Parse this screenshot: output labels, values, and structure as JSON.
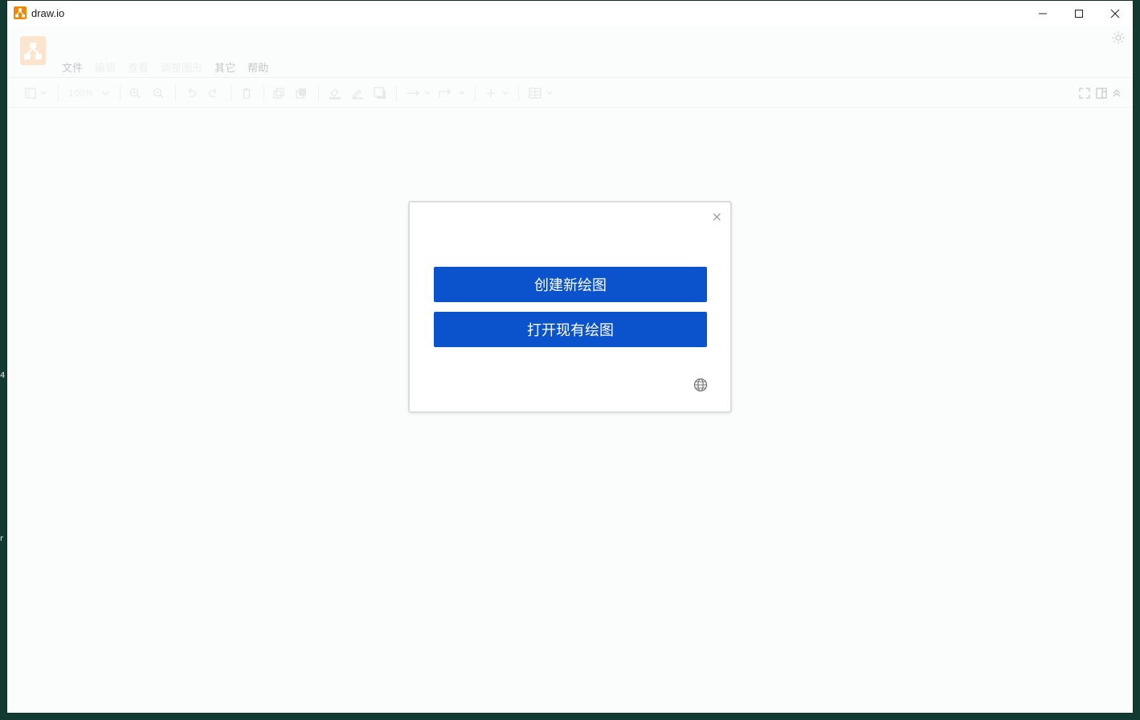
{
  "window": {
    "title": "draw.io"
  },
  "menu": {
    "items": [
      {
        "label": "文件",
        "enabled": true
      },
      {
        "label": "编辑",
        "enabled": false
      },
      {
        "label": "查看",
        "enabled": false
      },
      {
        "label": "调整图形",
        "enabled": false
      },
      {
        "label": "其它",
        "enabled": true
      },
      {
        "label": "帮助",
        "enabled": true
      }
    ]
  },
  "toolbar": {
    "zoom_label": "100%"
  },
  "dialog": {
    "create_label": "创建新绘图",
    "open_label": "打开现有绘图",
    "close_glyph": "×"
  },
  "background": {
    "glyph_a": "4",
    "glyph_b": "r"
  },
  "colors": {
    "primary_button": "#0b52cd",
    "logo_bg": "#fde5cd",
    "app_icon": "#f08705",
    "desktop": "#123a30"
  }
}
